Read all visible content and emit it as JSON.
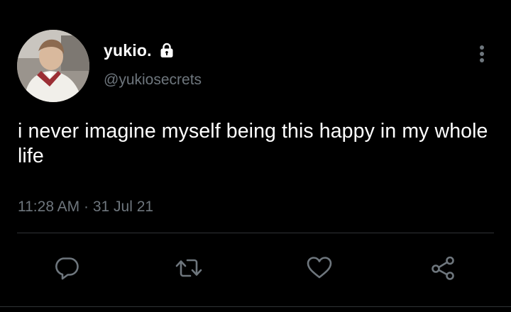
{
  "tweet": {
    "display_name": "yukio.",
    "handle": "@yukiosecrets",
    "text": "i never imagine myself being this happy in my whole life",
    "time": "11:28 AM",
    "separator": "·",
    "date": "31 Jul 21"
  },
  "icons": {
    "lock": "lock-icon",
    "more": "more-vertical-icon",
    "reply": "reply-icon",
    "retweet": "retweet-icon",
    "like": "heart-icon",
    "share": "share-icon"
  },
  "colors": {
    "background": "#000000",
    "text_primary": "#ffffff",
    "text_secondary": "#6e767d",
    "divider": "#2f3336"
  }
}
